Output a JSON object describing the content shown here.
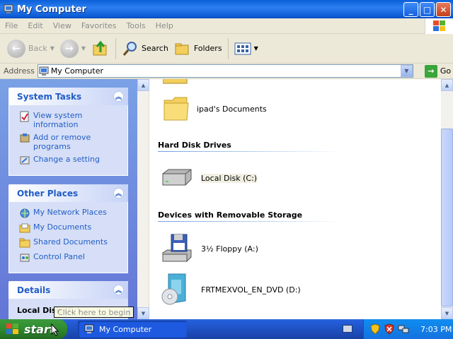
{
  "window": {
    "title": "My Computer"
  },
  "menu": [
    "File",
    "Edit",
    "View",
    "Favorites",
    "Tools",
    "Help"
  ],
  "toolbar": {
    "back": "Back",
    "search": "Search",
    "folders": "Folders"
  },
  "address": {
    "label": "Address",
    "value": "My Computer",
    "go": "Go"
  },
  "left_pane": {
    "system_tasks": {
      "title": "System Tasks",
      "items": [
        "View system information",
        "Add or remove programs",
        "Change a setting"
      ]
    },
    "other_places": {
      "title": "Other Places",
      "items": [
        "My Network Places",
        "My Documents",
        "Shared Documents",
        "Control Panel"
      ]
    },
    "details": {
      "title": "Details",
      "name": "Local Disk (C:)"
    }
  },
  "tooltip": "Click here to begin",
  "main": {
    "folder_item": "ipad's Documents",
    "hard_disk": {
      "title": "Hard Disk Drives",
      "items": [
        "Local Disk (C:)"
      ]
    },
    "removable": {
      "title": "Devices with Removable Storage",
      "items": [
        "3½ Floppy (A:)",
        "FRTMEXVOL_EN_DVD (D:)"
      ]
    }
  },
  "taskbar": {
    "start": "start",
    "task": "My Computer",
    "clock": "7:03 PM"
  },
  "colors": {
    "title_blue": "#0a5fd8",
    "link_blue": "#215dc6",
    "start_green": "#2f8a2f",
    "tray_blue": "#0f8ef0"
  }
}
